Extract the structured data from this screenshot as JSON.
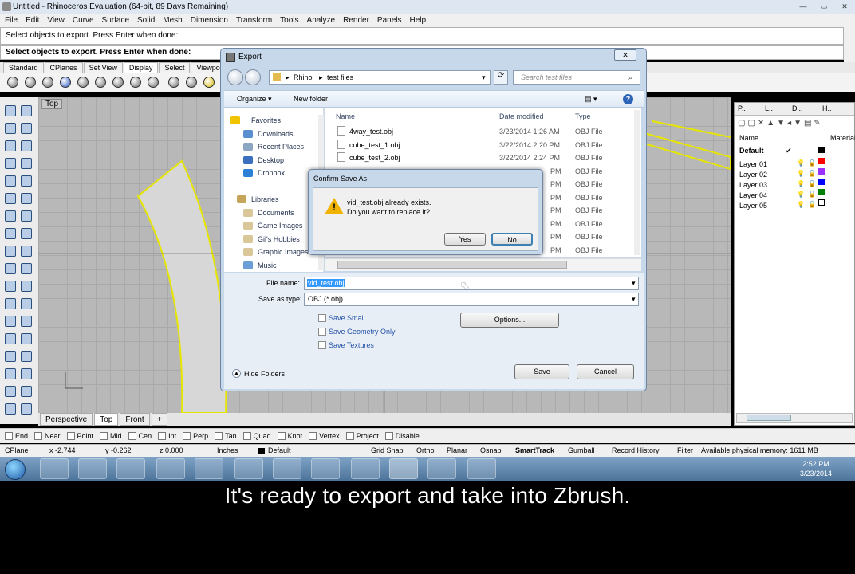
{
  "app": {
    "title": "Untitled - Rhinoceros Evaluation (64-bit, 89 Days Remaining)",
    "menu": [
      "File",
      "Edit",
      "View",
      "Curve",
      "Surface",
      "Solid",
      "Mesh",
      "Dimension",
      "Transform",
      "Tools",
      "Analyze",
      "Render",
      "Panels",
      "Help"
    ],
    "command_history": "Select objects to export. Press Enter when done:",
    "command_prompt": "Select objects to export. Press Enter when done:",
    "toolbar_tabs": [
      "Standard",
      "CPlanes",
      "Set View",
      "Display",
      "Select",
      "Viewport L"
    ],
    "viewport_label": "Top",
    "view_tabs": [
      "Perspective",
      "Top",
      "Front"
    ],
    "view_tab_add": "+"
  },
  "layers": {
    "header_name": "Name",
    "header_material": "Material",
    "rows": [
      {
        "name": "Default",
        "check": "✔",
        "color": "#000000"
      },
      {
        "name": "Layer 01",
        "color": "#ff0000"
      },
      {
        "name": "Layer 02",
        "color": "#9b30ff"
      },
      {
        "name": "Layer 03",
        "color": "#0000ff"
      },
      {
        "name": "Layer 04",
        "color": "#008000"
      },
      {
        "name": "Layer 05",
        "color": "#ffffff"
      }
    ],
    "tabs": [
      "P..",
      "L..",
      "Di..",
      "H.."
    ]
  },
  "osnap": [
    "End",
    "Near",
    "Point",
    "Mid",
    "Cen",
    "Int",
    "Perp",
    "Tan",
    "Quad",
    "Knot",
    "Vertex",
    "Project",
    "Disable"
  ],
  "status": {
    "cplane": "CPlane",
    "x": "x -2.744",
    "y": "y -0.262",
    "z": "z 0.000",
    "units": "Inches",
    "layer": "Default",
    "toggles": [
      "Grid Snap",
      "Ortho",
      "Planar",
      "Osnap",
      "SmartTrack",
      "Gumball",
      "Record History",
      "Filter"
    ],
    "memory": "Available physical memory: 1611 MB"
  },
  "taskbar": {
    "time": "2:52 PM",
    "date": "3/23/2014"
  },
  "caption": "It's ready to export and take into Zbrush.",
  "export_dialog": {
    "title": "Export",
    "close": "✕",
    "path": [
      "Rhino",
      "test files"
    ],
    "search_placeholder": "Search test files",
    "organize": "Organize ▾",
    "new_folder": "New folder",
    "favorites_header": "Favorites",
    "favorites": [
      "Downloads",
      "Recent Places",
      "Desktop",
      "Dropbox"
    ],
    "libraries_header": "Libraries",
    "libraries": [
      "Documents",
      "Game Images",
      "Gil's Hobbies",
      "Graphic Images",
      "Music"
    ],
    "columns": [
      "Name",
      "Date modified",
      "Type"
    ],
    "files": [
      {
        "name": "4way_test.obj",
        "date": "3/23/2014 1:26 AM",
        "type": "OBJ File"
      },
      {
        "name": "cube_test_1.obj",
        "date": "3/22/2014 2:20 PM",
        "type": "OBJ File"
      },
      {
        "name": "cube_test_2.obj",
        "date": "3/22/2014 2:24 PM",
        "type": "OBJ File"
      },
      {
        "name": "",
        "date": "PM",
        "type": "OBJ File"
      },
      {
        "name": "",
        "date": "PM",
        "type": "OBJ File"
      },
      {
        "name": "",
        "date": "PM",
        "type": "OBJ File"
      },
      {
        "name": "",
        "date": "PM",
        "type": "OBJ File"
      },
      {
        "name": "",
        "date": "PM",
        "type": "OBJ File"
      },
      {
        "name": "",
        "date": "PM",
        "type": "OBJ File"
      },
      {
        "name": "",
        "date": "PM",
        "type": "OBJ File"
      }
    ],
    "file_name_label": "File name:",
    "file_name_value": "vid_test.obj",
    "save_as_type_label": "Save as type:",
    "save_as_type_value": "OBJ (*.obj)",
    "options": [
      "Save Small",
      "Save Geometry Only",
      "Save Textures"
    ],
    "options_button": "Options...",
    "hide_folders": "Hide Folders",
    "save_button": "Save",
    "cancel_button": "Cancel"
  },
  "confirm_dialog": {
    "title": "Confirm Save As",
    "line1": "vid_test.obj already exists.",
    "line2": "Do you want to replace it?",
    "yes": "Yes",
    "no": "No"
  }
}
